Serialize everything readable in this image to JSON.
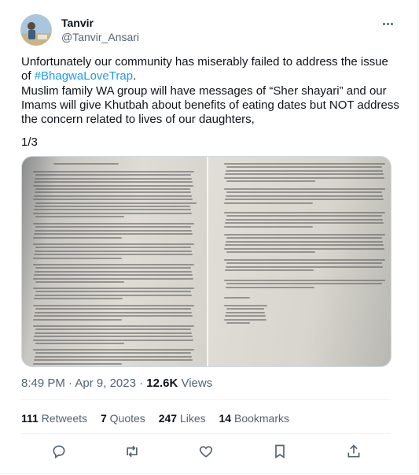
{
  "author": {
    "name": "Tanvir",
    "handle": "@Tanvir_Ansari"
  },
  "tweet": {
    "line1": "Unfortunately our community has miserably failed to address the issue",
    "line2_prefix": "of ",
    "hashtag": "#BhagwaLoveTrap",
    "line2_suffix": ".",
    "body": "Muslim family WA group will have messages of “Sher shayari” and our\nImams will give Khutbah about benefits of eating dates but NOT address\nthe concern related to lives of our daughters,",
    "thread_counter": "1/3"
  },
  "meta": {
    "time": "8:49 PM",
    "dot": " · ",
    "date": "Apr 9, 2023",
    "views_count": "12.6K",
    "views_label": " Views"
  },
  "stats": [
    {
      "count": "111",
      "label": " Retweets"
    },
    {
      "count": "7",
      "label": " Quotes"
    },
    {
      "count": "247",
      "label": " Likes"
    },
    {
      "count": "14",
      "label": " Bookmarks"
    }
  ],
  "actions": [
    "reply-icon",
    "retweet-icon",
    "like-icon",
    "bookmark-icon",
    "share-icon"
  ],
  "colors": {
    "link": "#1d9bf0",
    "secondary": "#536471",
    "text": "#0f1419"
  }
}
